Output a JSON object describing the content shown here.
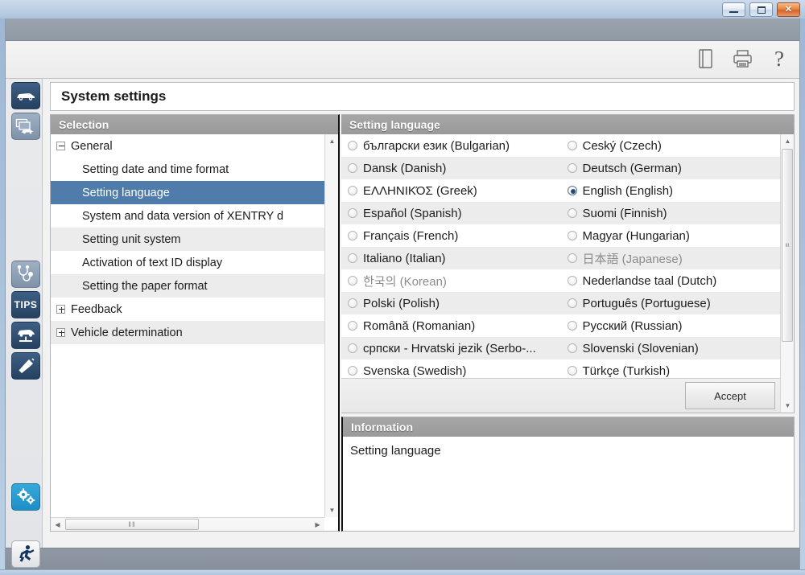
{
  "window": {
    "minimize_label": "Minimize",
    "maximize_label": "Maximize",
    "close_label": "Close"
  },
  "toolbar": {
    "document_icon": "book-icon",
    "print_icon": "printer-icon",
    "help_label": "?"
  },
  "rail": {
    "items": [
      {
        "icon": "car-icon",
        "label": "Vehicle"
      },
      {
        "icon": "documents-car-icon",
        "label": "Documents"
      },
      {
        "icon": "stethoscope-icon",
        "label": "Diagnosis"
      },
      {
        "icon": "tips-icon",
        "label": "TIPS"
      },
      {
        "icon": "car-lift-icon",
        "label": "Workshop"
      },
      {
        "icon": "screwdriver-icon",
        "label": "Tools"
      },
      {
        "icon": "gears-icon",
        "label": "Settings"
      }
    ],
    "run_icon": "running-man-icon",
    "run_label": "Exit"
  },
  "page_title": "System settings",
  "selection": {
    "header": "Selection",
    "nodes": [
      {
        "label": "General",
        "level": 0,
        "state": "expanded",
        "selected": false
      },
      {
        "label": "Setting date and time format",
        "level": 1,
        "state": "leaf",
        "selected": false
      },
      {
        "label": "Setting language",
        "level": 1,
        "state": "leaf",
        "selected": true
      },
      {
        "label": "System and data version of XENTRY d",
        "level": 1,
        "state": "leaf",
        "selected": false
      },
      {
        "label": "Setting unit system",
        "level": 1,
        "state": "leaf",
        "selected": false
      },
      {
        "label": "Activation of text ID display",
        "level": 1,
        "state": "leaf",
        "selected": false
      },
      {
        "label": "Setting the paper format",
        "level": 1,
        "state": "leaf",
        "selected": false
      },
      {
        "label": "Feedback",
        "level": 0,
        "state": "collapsed",
        "selected": false
      },
      {
        "label": "Vehicle determination",
        "level": 0,
        "state": "collapsed",
        "selected": false
      }
    ],
    "hscroll_grip": "‖‖",
    "scroll_up": "▲",
    "scroll_down": "▼",
    "scroll_left": "◀",
    "scroll_right": "▶"
  },
  "language_panel": {
    "header": "Setting language",
    "accept_label": "Accept",
    "selected_value": "English (English)",
    "scroll_up": "▲",
    "scroll_down": "▼",
    "scroll_grip": "≡",
    "rows": [
      {
        "left": {
          "label": "български език (Bulgarian)",
          "checked": false,
          "dim": false
        },
        "right": {
          "label": "Ceský (Czech)",
          "checked": false,
          "dim": false
        }
      },
      {
        "left": {
          "label": "Dansk (Danish)",
          "checked": false,
          "dim": false
        },
        "right": {
          "label": "Deutsch (German)",
          "checked": false,
          "dim": false
        }
      },
      {
        "left": {
          "label": "EΛΛHNIKΌΣ (Greek)",
          "checked": false,
          "dim": false
        },
        "right": {
          "label": "English (English)",
          "checked": true,
          "dim": false
        }
      },
      {
        "left": {
          "label": "Español (Spanish)",
          "checked": false,
          "dim": false
        },
        "right": {
          "label": "Suomi (Finnish)",
          "checked": false,
          "dim": false
        }
      },
      {
        "left": {
          "label": "Français (French)",
          "checked": false,
          "dim": false
        },
        "right": {
          "label": "Magyar (Hungarian)",
          "checked": false,
          "dim": false
        }
      },
      {
        "left": {
          "label": "Italiano (Italian)",
          "checked": false,
          "dim": false
        },
        "right": {
          "label": "日本語 (Japanese)",
          "checked": false,
          "dim": true
        }
      },
      {
        "left": {
          "label": "한국의 (Korean)",
          "checked": false,
          "dim": true
        },
        "right": {
          "label": "Nederlandse taal (Dutch)",
          "checked": false,
          "dim": false
        }
      },
      {
        "left": {
          "label": "Polski (Polish)",
          "checked": false,
          "dim": false
        },
        "right": {
          "label": "Português (Portuguese)",
          "checked": false,
          "dim": false
        }
      },
      {
        "left": {
          "label": "Română (Romanian)",
          "checked": false,
          "dim": false
        },
        "right": {
          "label": "Русский (Russian)",
          "checked": false,
          "dim": false
        }
      },
      {
        "left": {
          "label": "српски - Hrvatski jezik (Serbo-...",
          "checked": false,
          "dim": false
        },
        "right": {
          "label": "Slovenski (Slovenian)",
          "checked": false,
          "dim": false
        }
      },
      {
        "left": {
          "label": "Svenska (Swedish)",
          "checked": false,
          "dim": false
        },
        "right": {
          "label": "Türkçe (Turkish)",
          "checked": false,
          "dim": false
        }
      }
    ]
  },
  "information": {
    "header": "Information",
    "text": "Setting language"
  },
  "colors": {
    "header_gray": "#9f9f9f",
    "selection_blue": "#4f7cab",
    "rail_dark_blue": "#2b4767",
    "rail_cyan": "#23a0d5",
    "radio_dot": "#274d73",
    "desktop_blue": "#a9c0da"
  }
}
